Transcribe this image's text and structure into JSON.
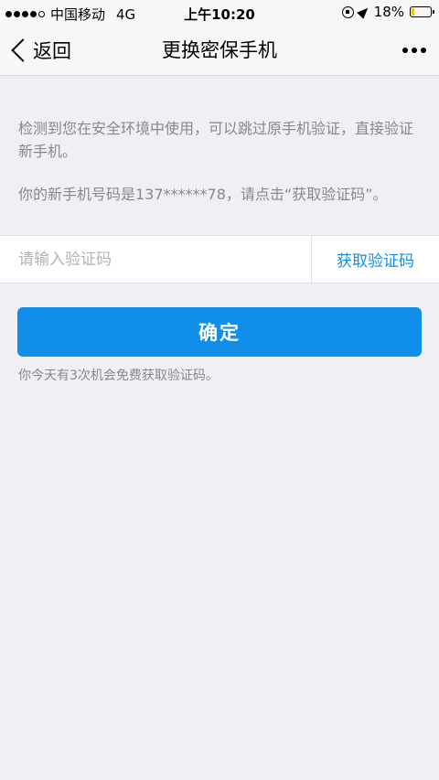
{
  "status_bar": {
    "carrier": "中国移动",
    "network": "4G",
    "time": "上午10:20",
    "battery_percent": "18%",
    "battery_level": 0.18,
    "icons": [
      "signal-dots-icon",
      "lock-rotation-icon",
      "location-icon",
      "battery-icon"
    ]
  },
  "nav": {
    "back_label": "返回",
    "title": "更换密保手机",
    "more_icon": "more-dots-icon"
  },
  "content": {
    "info_1": "检测到您在安全环境中使用，可以跳过原手机验证，直接验证新手机。",
    "info_2": "你的新手机号码是137******78，请点击“获取验证码”。"
  },
  "code_field": {
    "placeholder": "请输入验证码",
    "value": "",
    "get_code_label": "获取验证码"
  },
  "confirm_label": "确定",
  "chance_note": "你今天有3次机会免费获取验证码。",
  "colors": {
    "accent": "#108ee9",
    "background": "#efeff4",
    "battery": "#f5c400"
  }
}
